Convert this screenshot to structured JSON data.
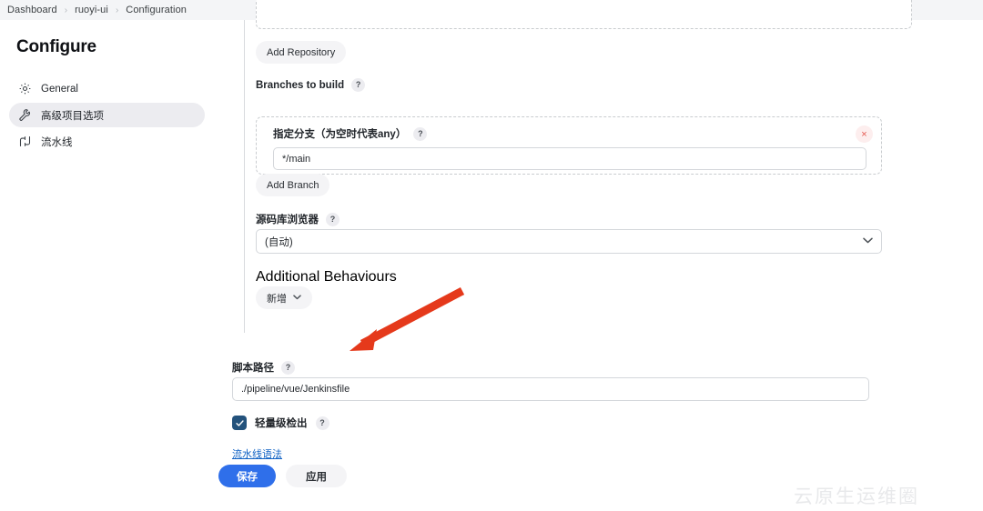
{
  "breadcrumb": {
    "items": [
      {
        "label": "Dashboard"
      },
      {
        "label": "ruoyi-ui"
      },
      {
        "label": "Configuration"
      }
    ],
    "separator": "›"
  },
  "sidebar": {
    "title": "Configure",
    "items": [
      {
        "label": "General",
        "icon": "gear-icon",
        "selected": false
      },
      {
        "label": "高级项目选项",
        "icon": "wrench-icon",
        "selected": true
      },
      {
        "label": "流水线",
        "icon": "pipeline-icon",
        "selected": false
      }
    ]
  },
  "main": {
    "add_repository_label": "Add Repository",
    "branches_to_build": {
      "label": "Branches to build",
      "help": "?"
    },
    "branch_spec": {
      "label": "指定分支（为空时代表any）",
      "help": "?",
      "value": "*/main",
      "placeholder": "",
      "delete_label": "×"
    },
    "add_branch_label": "Add Branch",
    "repo_browser": {
      "label": "源码库浏览器",
      "help": "?",
      "value": "(自动)",
      "chevron": "⌄"
    },
    "additional_behaviours": {
      "label": "Additional Behaviours",
      "add_label": "新增",
      "caret": "⌄"
    },
    "script_path": {
      "label": "脚本路径",
      "help": "?",
      "value": "./pipeline/vue/Jenkinsfile",
      "placeholder": ""
    },
    "lightweight_checkout": {
      "label": "轻量级检出",
      "help": "?",
      "checked": true
    },
    "pipeline_syntax_link": "流水线语法"
  },
  "footer": {
    "save_label": "保存",
    "apply_label": "应用"
  },
  "annotation": {
    "arrow_color": "#e5391b"
  },
  "watermark": {
    "text": "云原生运维圈"
  },
  "colors": {
    "primary_blue": "#2f6fea",
    "link_blue": "#1062c4",
    "checkbox_navy": "#23527c",
    "topbar_bg": "#f4f5f7",
    "selected_pill": "#ececf0"
  }
}
